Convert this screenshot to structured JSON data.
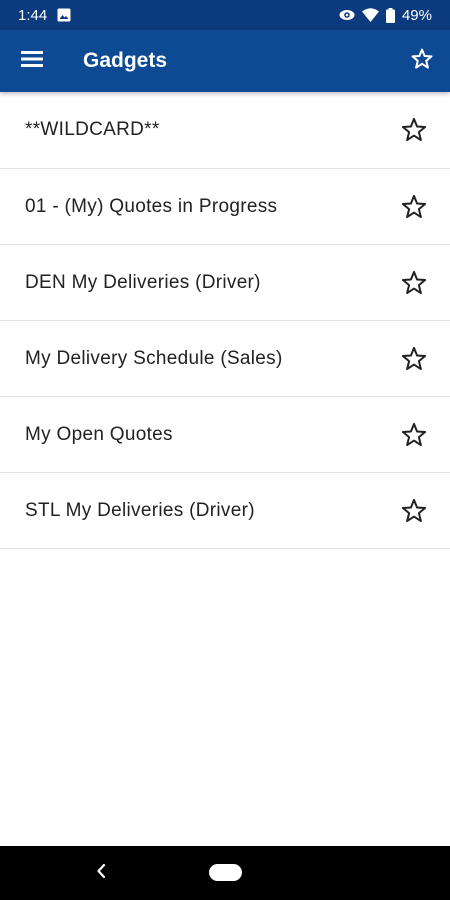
{
  "status_bar": {
    "time": "1:44",
    "battery": "49%",
    "icons": [
      "image-notification-icon",
      "eye-comfort-icon",
      "wifi-icon",
      "battery-icon"
    ]
  },
  "app_bar": {
    "title": "Gadgets",
    "icons": [
      "menu-icon",
      "star-outline-icon"
    ]
  },
  "gadgets": [
    {
      "label": "**WILDCARD**"
    },
    {
      "label": "01 - (My) Quotes in Progress"
    },
    {
      "label": "DEN My Deliveries (Driver)"
    },
    {
      "label": "My Delivery Schedule (Sales)"
    },
    {
      "label": "My Open Quotes"
    },
    {
      "label": "STL My Deliveries (Driver)"
    }
  ],
  "nav_bar": {
    "icons": [
      "back-icon",
      "home-pill-icon"
    ]
  },
  "colors": {
    "status_bar": "#0b3a7e",
    "app_bar": "#0e4a94",
    "text": "#222222",
    "divider": "#e2e2e2"
  }
}
